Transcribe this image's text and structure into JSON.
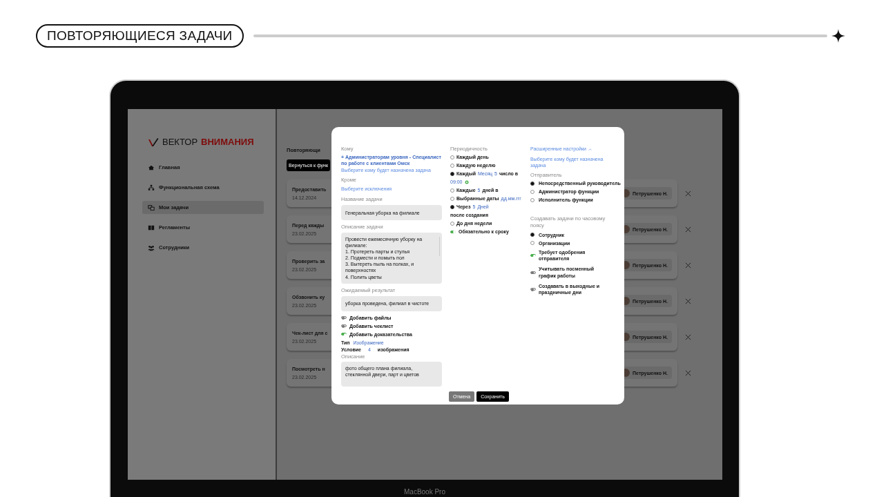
{
  "slide": {
    "title": "ПОВТОРЯЮЩИЕСЯ ЗАДАЧИ"
  },
  "laptop": {
    "model_label": "MacBook Pro"
  },
  "sidebar": {
    "logo": {
      "part_1": "ВЕКТОР",
      "part_2": "ВНИМАНИЯ"
    },
    "items": [
      {
        "label": "Главная",
        "kind": "home",
        "selected": false
      },
      {
        "label": "Функциональная схема",
        "kind": "hierarchy",
        "selected": false
      },
      {
        "label": "Мои задачи",
        "kind": "chat",
        "selected": true
      },
      {
        "label": "Регламенты",
        "kind": "book",
        "selected": false
      },
      {
        "label": "Сотрудники",
        "kind": "people",
        "selected": false
      }
    ]
  },
  "main": {
    "title": "Повторяющи",
    "back_button": "Вернуться к функ",
    "tasks": [
      {
        "title": "Предоставить",
        "date": "14.12.2024",
        "assignee": "Петрушенко Н."
      },
      {
        "title": "Перед кажды",
        "date": "23.02.2025",
        "assignee": "Петрушенко Н."
      },
      {
        "title": "Проверить за",
        "date": "23.02.2025",
        "assignee": "Петрушенко Н."
      },
      {
        "title": "Обзвонить ку",
        "date": "23.02.2025",
        "assignee": "Петрушенко Н."
      },
      {
        "title": "Чек-лист для с",
        "date": "23.02.2025",
        "assignee": "Петрушенко Н."
      },
      {
        "title": "Посмотреть н",
        "date": "23.02.2025",
        "assignee": "Петрушенко Н."
      }
    ]
  },
  "modal": {
    "recipients": {
      "label": "Кому",
      "selected": "+ Администраторам уровня - Специалист по работе с клиентами Омск",
      "picker": "Выберите кому будет назначена задача"
    },
    "except": {
      "label": "Кроме",
      "picker": "Выберите исключения"
    },
    "task_name": {
      "label": "Название задачи",
      "value": "Генеральная уборка на филиале"
    },
    "description": {
      "label": "Описание задачи",
      "lines": [
        "Провести ежемесячную уборку на филиале:",
        "1. Протереть парты и стулья",
        "2. Подмести и помыть пол",
        "3. Вытереть пыль на полках, и поверхностях",
        "4. Полить цветы"
      ]
    },
    "expected_result": {
      "label": "Ожидаемый результат",
      "value": "уборка проведена, филиал в чистоте"
    },
    "options": [
      {
        "label": "Добавить файлы",
        "on": false
      },
      {
        "label": "Добавить чеклист",
        "on": false
      },
      {
        "label": "Добавить доказательства",
        "on": true
      }
    ],
    "proof": {
      "type_label": "Тип",
      "type_value": "Изображение",
      "condition_label": "Условие",
      "condition_value": "4",
      "condition_unit": "изображения",
      "description_label": "Описание",
      "description_value": "фото общего плана филиала, стеклянной двери, парт и цветов"
    },
    "periodicity": {
      "label": "Периодичность",
      "options": [
        {
          "selected": false,
          "lines": [
            [
              {
                "kind": "text",
                "text": "Каждый день"
              }
            ]
          ]
        },
        {
          "selected": false,
          "lines": [
            [
              {
                "kind": "text",
                "text": "Каждую неделю"
              }
            ]
          ]
        },
        {
          "selected": true,
          "lines": [
            [
              {
                "kind": "text",
                "text": "Каждый"
              },
              {
                "kind": "value",
                "text": "Месяц"
              },
              {
                "kind": "value",
                "text": "5"
              },
              {
                "kind": "text",
                "text": "число в"
              }
            ],
            [
              {
                "kind": "value",
                "text": "09:00"
              },
              {
                "kind": "confirm"
              }
            ]
          ]
        },
        {
          "selected": false,
          "lines": [
            [
              {
                "kind": "text",
                "text": "Каждые"
              },
              {
                "kind": "value",
                "text": "5"
              },
              {
                "kind": "text",
                "text": "дней в"
              }
            ]
          ]
        },
        {
          "selected": false,
          "lines": [
            [
              {
                "kind": "text",
                "text": "Выбранные даты"
              },
              {
                "kind": "small",
                "text": "дд.мм.ггг"
              }
            ]
          ]
        },
        {
          "selected": true,
          "lines": [
            [
              {
                "kind": "text",
                "text": "Через"
              },
              {
                "kind": "value",
                "text": "5"
              },
              {
                "kind": "value",
                "text": "Дней"
              }
            ],
            [
              {
                "kind": "text",
                "text": "после создания"
              }
            ]
          ]
        },
        {
          "selected": false,
          "lines": [
            [
              {
                "kind": "text",
                "text": "До дня недели"
              }
            ]
          ]
        }
      ],
      "deadline_toggle": {
        "label": "Обязательно к сроку",
        "on": true
      }
    },
    "advanced": {
      "title": "Расширенные настройки",
      "expanded": true,
      "picker": "Выберите кому будет назначена задача"
    },
    "sender": {
      "label": "Отправитель",
      "options": [
        {
          "label": "Непосредственный руководитель",
          "selected": true
        },
        {
          "label": "Администратор функции",
          "selected": false
        },
        {
          "label": "Исполнитель функции",
          "selected": false
        }
      ]
    },
    "timezone": {
      "label": "Создавать задачи по часовому поясу",
      "options": [
        {
          "label": "Сотрудник",
          "selected": true
        },
        {
          "label": "Организации",
          "selected": false
        }
      ]
    },
    "toggles": [
      {
        "label": "Требует одобрения отправителя",
        "on": true
      },
      {
        "label": "Учитывать посменный график работы",
        "on": false
      },
      {
        "label": "Создавать в выходные и праздничные дни",
        "on": false
      }
    ],
    "buttons": {
      "cancel": "Отмена",
      "save": "Сохранить"
    }
  }
}
